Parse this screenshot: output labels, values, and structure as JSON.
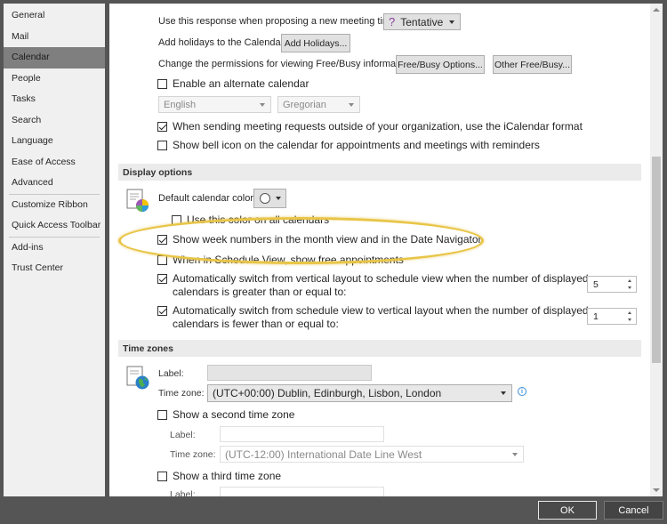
{
  "sidebar": {
    "items": [
      {
        "label": "General"
      },
      {
        "label": "Mail"
      },
      {
        "label": "Calendar",
        "selected": true
      },
      {
        "label": "People"
      },
      {
        "label": "Tasks"
      },
      {
        "label": "Search"
      },
      {
        "label": "Language"
      },
      {
        "label": "Ease of Access"
      },
      {
        "label": "Advanced"
      },
      {
        "label": "Customize Ribbon"
      },
      {
        "label": "Quick Access Toolbar"
      },
      {
        "label": "Add-ins"
      },
      {
        "label": "Trust Center"
      }
    ]
  },
  "calendar_options": {
    "proposing_label": "Use this response when proposing a new meeting time:",
    "proposing_value": "Tentative",
    "proposing_icon": "question-mark-icon",
    "holidays_label": "Add holidays to the Calendar:",
    "holidays_button": "Add Holidays...",
    "permissions_label": "Change the permissions for viewing Free/Busy information:",
    "freebusy_button": "Free/Busy Options...",
    "other_freebusy_button": "Other Free/Busy...",
    "alternate_calendar_label": "Enable an alternate calendar",
    "alternate_calendar_checked": false,
    "alt_language_value": "English",
    "alt_type_value": "Gregorian",
    "icalendar_label": "When sending meeting requests outside of your organization, use the iCalendar format",
    "icalendar_checked": true,
    "bell_icon_label": "Show bell icon on the calendar for appointments and meetings with reminders",
    "bell_icon_checked": false
  },
  "display_options": {
    "header": "Display options",
    "default_color_label": "Default calendar color:",
    "use_color_all_label": "Use this color on all calendars",
    "use_color_all_checked": false,
    "week_numbers_label": "Show week numbers in the month view and in the Date Navigator",
    "week_numbers_checked": true,
    "free_appointments_label": "When in Schedule View, show free appointments",
    "free_appointments_checked": false,
    "auto_schedule_label_1": "Automatically switch from vertical layout to schedule view when the number of displayed",
    "auto_schedule_label_2": "calendars is greater than or equal to:",
    "auto_schedule_checked": true,
    "auto_schedule_value": "5",
    "auto_vertical_label_1": "Automatically switch from schedule view to vertical layout when the number of displayed",
    "auto_vertical_label_2": "calendars is fewer than or equal to:",
    "auto_vertical_checked": true,
    "auto_vertical_value": "1"
  },
  "time_zones": {
    "header": "Time zones",
    "label_label": "Label:",
    "label_value": "",
    "timezone_label": "Time zone:",
    "timezone_value": "(UTC+00:00) Dublin, Edinburgh, Lisbon, London",
    "second_tz_label": "Show a second time zone",
    "second_tz_checked": false,
    "second_label_label": "Label:",
    "second_timezone_label": "Time zone:",
    "second_timezone_value": "(UTC-12:00) International Date Line West",
    "third_tz_label": "Show a third time zone",
    "third_tz_checked": false,
    "third_label_label": "Label:"
  },
  "footer": {
    "ok": "OK",
    "cancel": "Cancel"
  },
  "colors": {
    "highlight": "#e8c547",
    "sidebar_selected": "#7f7f7f",
    "dialog_background": "#555555"
  }
}
